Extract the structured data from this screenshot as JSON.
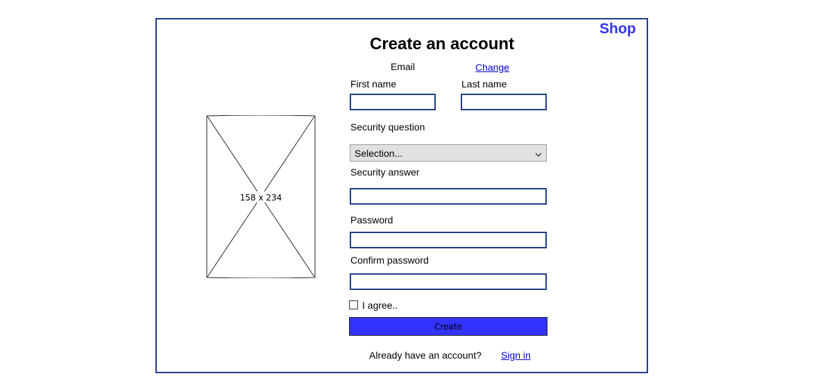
{
  "header": {
    "brand": "Shop",
    "title": "Create an account"
  },
  "form": {
    "email_label": "Email",
    "change_link": "Change",
    "first_name_label": "First name",
    "last_name_label": "Last name",
    "first_name_value": "",
    "last_name_value": "",
    "security_question_label": "Security question",
    "security_question_selected": "Selection...",
    "security_answer_label": "Security answer",
    "security_answer_value": "",
    "password_label": "Password",
    "password_value": "",
    "confirm_password_label": "Confirm password",
    "confirm_password_value": "",
    "agree_label": "I agree..",
    "agree_checked": false,
    "create_button": "Create"
  },
  "footer": {
    "prompt": "Already have an account?",
    "sign_in_link": "Sign in"
  },
  "image_placeholder": {
    "label": "158 x 234"
  },
  "colors": {
    "frame_border": "#1f3a8a",
    "brand": "#3333ee",
    "button": "#3333ff",
    "link": "#0000cc"
  }
}
